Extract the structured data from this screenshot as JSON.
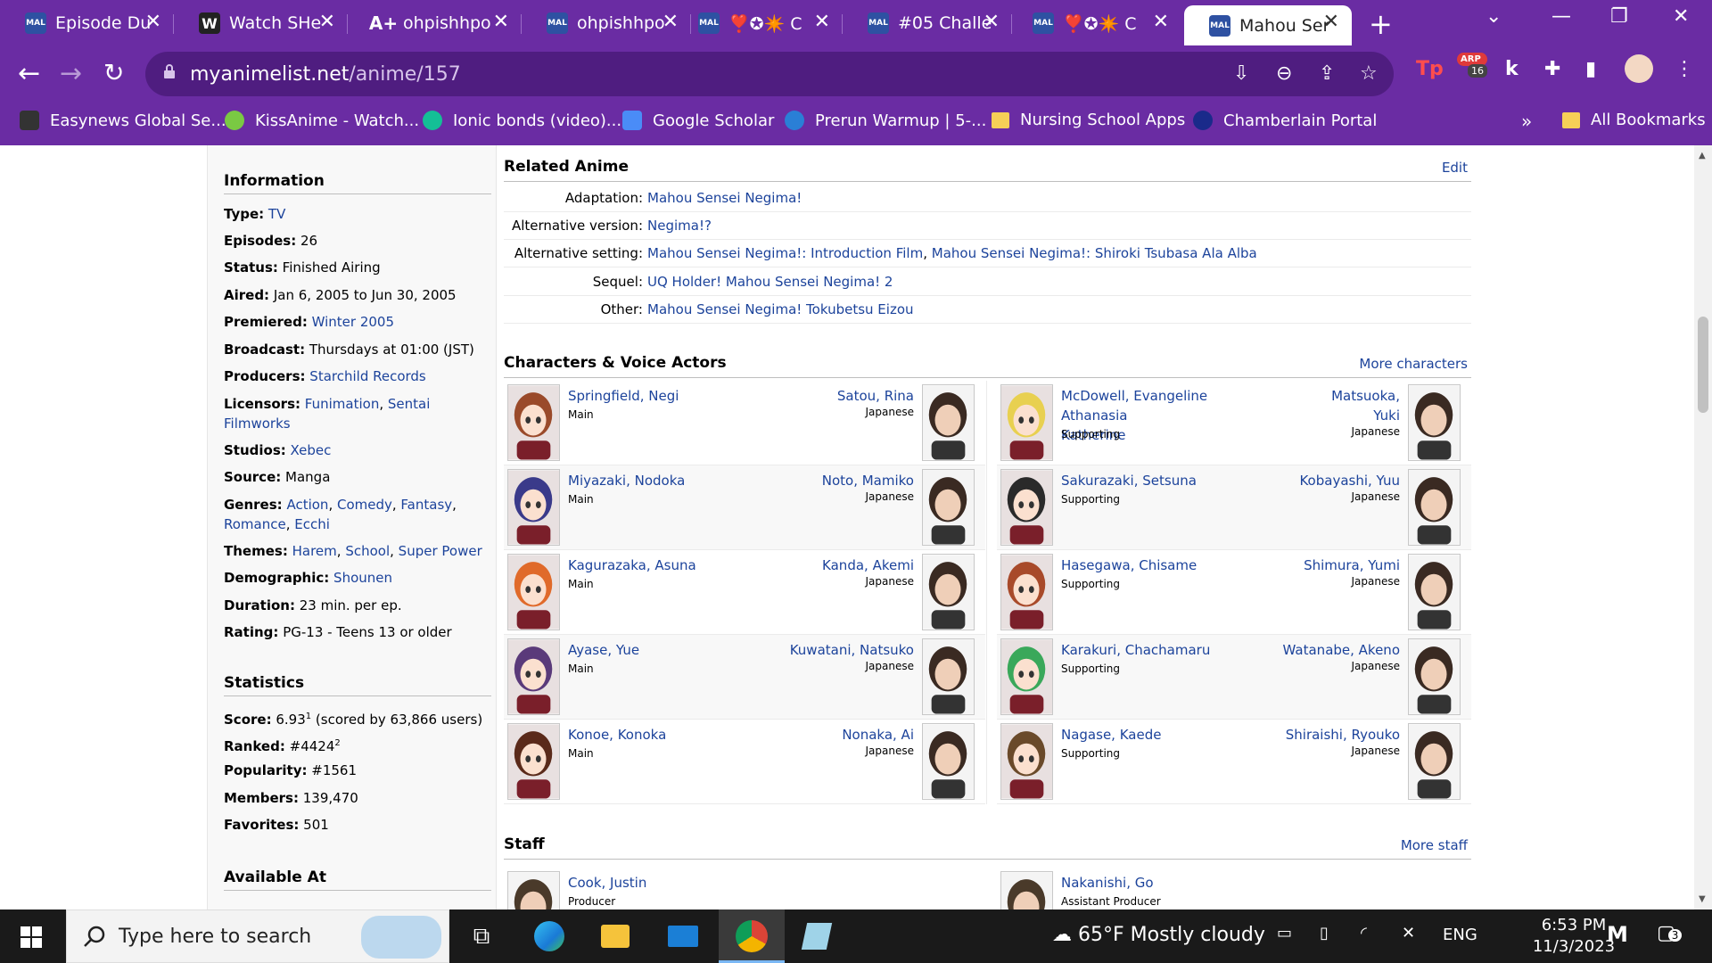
{
  "browser": {
    "tabs": [
      {
        "title": "Episode Du",
        "favicon": "MAL"
      },
      {
        "title": "Watch SHe",
        "favicon": "W"
      },
      {
        "title": "ohpishhpo",
        "favicon": "A+"
      },
      {
        "title": "ohpishhpo",
        "favicon": "MAL"
      },
      {
        "title": "❣️✪✴️ C",
        "favicon": "MAL"
      },
      {
        "title": "#05 Challe",
        "favicon": "MAL"
      },
      {
        "title": "❣️✪✴️ C",
        "favicon": "MAL"
      },
      {
        "title": "Mahou Ser",
        "favicon": "MAL",
        "active": true
      }
    ],
    "url_host": "myanimelist.net",
    "url_path": "/anime/157",
    "ext_badge": "16",
    "ext_badge_label": "ARP",
    "bookmarks": [
      {
        "label": "Easynews Global Se..."
      },
      {
        "label": "KissAnime - Watch..."
      },
      {
        "label": "Ionic bonds (video)..."
      },
      {
        "label": "Google Scholar"
      },
      {
        "label": "Prerun Warmup | 5-..."
      },
      {
        "label": "Nursing School Apps"
      },
      {
        "label": "Chamberlain Portal"
      }
    ],
    "more_bookmarks": "»",
    "all_bookmarks": "All Bookmarks"
  },
  "sidebar": {
    "information_heading": "Information",
    "info": {
      "type_label": "Type:",
      "type_value": "TV",
      "episodes_label": "Episodes:",
      "episodes_value": "26",
      "status_label": "Status:",
      "status_value": "Finished Airing",
      "aired_label": "Aired:",
      "aired_value": "Jan 6, 2005 to Jun 30, 2005",
      "premiered_label": "Premiered:",
      "premiered_value": "Winter 2005",
      "broadcast_label": "Broadcast:",
      "broadcast_value": "Thursdays at 01:00 (JST)",
      "producers_label": "Producers:",
      "producers_value": "Starchild Records",
      "licensors_label": "Licensors:",
      "licensor_1": "Funimation",
      "licensor_2_a": "Sentai",
      "licensor_2_b": "Filmworks",
      "studios_label": "Studios:",
      "studios_value": "Xebec",
      "source_label": "Source:",
      "source_value": "Manga",
      "genres_label": "Genres:",
      "genre_1": "Action",
      "genre_2": "Comedy",
      "genre_3": "Fantasy",
      "genre_4": "Romance",
      "genre_5": "Ecchi",
      "themes_label": "Themes:",
      "theme_1": "Harem",
      "theme_2": "School",
      "theme_3": "Super Power",
      "demographic_label": "Demographic:",
      "demographic_value": "Shounen",
      "duration_label": "Duration:",
      "duration_value": "23 min. per ep.",
      "rating_label": "Rating:",
      "rating_value": "PG-13 - Teens 13 or older"
    },
    "statistics_heading": "Statistics",
    "stats": {
      "score_label": "Score:",
      "score_value": "6.93",
      "score_sup": "1",
      "score_note": "(scored by 63,866 users)",
      "ranked_label": "Ranked:",
      "ranked_value": "#4424",
      "ranked_sup": "2",
      "popularity_label": "Popularity:",
      "popularity_value": "#1561",
      "members_label": "Members:",
      "members_value": "139,470",
      "favorites_label": "Favorites:",
      "favorites_value": "501"
    },
    "available_heading": "Available At"
  },
  "related": {
    "heading": "Related Anime",
    "edit": "Edit",
    "rows": [
      {
        "label": "Adaptation:",
        "links": [
          "Mahou Sensei Negima!"
        ]
      },
      {
        "label": "Alternative version:",
        "links": [
          "Negima!?"
        ]
      },
      {
        "label": "Alternative setting:",
        "links": [
          "Mahou Sensei Negima!: Introduction Film",
          "Mahou Sensei Negima!: Shiroki Tsubasa Ala Alba"
        ]
      },
      {
        "label": "Sequel:",
        "links": [
          "UQ Holder! Mahou Sensei Negima! 2"
        ]
      },
      {
        "label": "Other:",
        "links": [
          "Mahou Sensei Negima! Tokubetsu Eizou"
        ]
      }
    ]
  },
  "characters": {
    "heading": "Characters & Voice Actors",
    "more": "More characters",
    "left": [
      {
        "name": "Springfield, Negi",
        "role": "Main",
        "va": "Satou, Rina",
        "lang": "Japanese",
        "hair": "#9a4a2a"
      },
      {
        "name": "Miyazaki, Nodoka",
        "role": "Main",
        "va": "Noto, Mamiko",
        "lang": "Japanese",
        "hair": "#3a3a8a"
      },
      {
        "name": "Kagurazaka, Asuna",
        "role": "Main",
        "va": "Kanda, Akemi",
        "lang": "Japanese",
        "hair": "#e06a2a"
      },
      {
        "name": "Ayase, Yue",
        "role": "Main",
        "va": "Kuwatani, Natsuko",
        "lang": "Japanese",
        "hair": "#5a3a7a"
      },
      {
        "name": "Konoe, Konoka",
        "role": "Main",
        "va": "Nonaka, Ai",
        "lang": "Japanese",
        "hair": "#5a2a1a"
      }
    ],
    "right": [
      {
        "name": "McDowell, Evangeline Athanasia",
        "name2": "Katherine",
        "role": "Supporting",
        "va": "Matsuoka,",
        "va2": "Yuki",
        "lang": "Japanese",
        "hair": "#e8d050"
      },
      {
        "name": "Sakurazaki, Setsuna",
        "role": "Supporting",
        "va": "Kobayashi, Yuu",
        "lang": "Japanese",
        "hair": "#2a2a2a"
      },
      {
        "name": "Hasegawa, Chisame",
        "role": "Supporting",
        "va": "Shimura, Yumi",
        "lang": "Japanese",
        "hair": "#a84a2a"
      },
      {
        "name": "Karakuri, Chachamaru",
        "role": "Supporting",
        "va": "Watanabe, Akeno",
        "lang": "Japanese",
        "hair": "#3aa85a"
      },
      {
        "name": "Nagase, Kaede",
        "role": "Supporting",
        "va": "Shiraishi, Ryouko",
        "lang": "Japanese",
        "hair": "#6a4a2a"
      }
    ]
  },
  "staff": {
    "heading": "Staff",
    "more": "More staff",
    "items": [
      {
        "name": "Cook, Justin",
        "role": "Producer"
      },
      {
        "name": "Nakanishi, Go",
        "role": "Assistant Producer"
      }
    ]
  },
  "taskbar": {
    "search_placeholder": "Type here to search",
    "weather": "65°F  Mostly cloudy",
    "lang": "ENG",
    "time": "6:53 PM",
    "date": "11/3/2023",
    "notif_count": "3"
  }
}
